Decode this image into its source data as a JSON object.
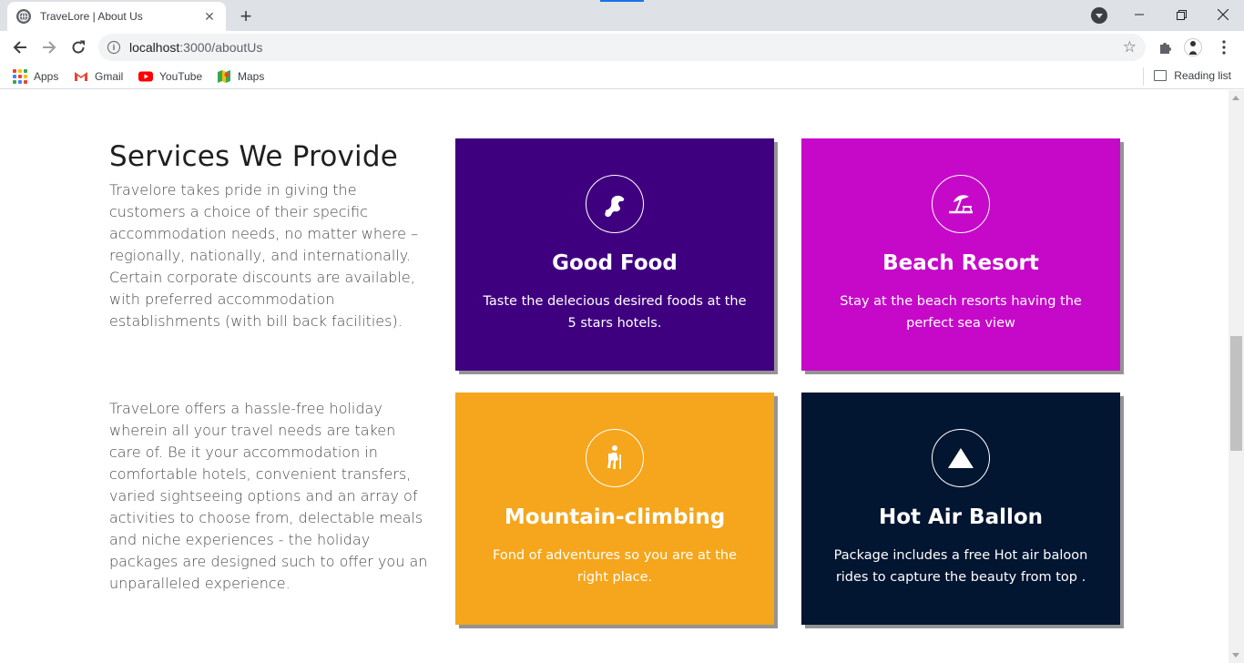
{
  "browser": {
    "tab_title": "TraveLore | About Us",
    "new_tab": "+",
    "url_host": "localhost",
    "url_path": ":3000/aboutUs",
    "bookmarks": [
      {
        "label": "Apps"
      },
      {
        "label": "Gmail"
      },
      {
        "label": "YouTube"
      },
      {
        "label": "Maps"
      }
    ],
    "reading_list": "Reading list"
  },
  "page": {
    "heading": "Services We Provide",
    "paragraph_1": "Travelore takes pride in giving the customers a choice of their specific accommodation needs, no matter where – regionally, nationally, and internationally. Certain corporate discounts are available, with preferred accommodation establishments (with bill back facilities).",
    "paragraph_2": "TraveLore offers a hassle-free holiday wherein all your travel needs are taken care of. Be it your accommodation in comfortable hotels, convenient transfers, varied sightseeing options and an array of activities to choose from, delectable meals and niche experiences - the holiday packages are designed such to offer you an unparalleled experience.",
    "cards": [
      {
        "title": "Good Food",
        "description": "Taste the delecious desired foods at the 5 stars hotels.",
        "icon": "food-icon",
        "color": "#3f0080"
      },
      {
        "title": "Beach Resort",
        "description": "Stay at the beach resorts having the perfect sea view",
        "icon": "beach-umbrella-icon",
        "color": "#c609c9"
      },
      {
        "title": "Mountain-climbing",
        "description": "Fond of adventures so you are at the right place.",
        "icon": "hiker-icon",
        "color": "#f5a61c"
      },
      {
        "title": "Hot Air Ballon",
        "description": "Package includes a free Hot air baloon rides to capture the beauty from top .",
        "icon": "mountain-icon",
        "color": "#021531"
      }
    ]
  }
}
